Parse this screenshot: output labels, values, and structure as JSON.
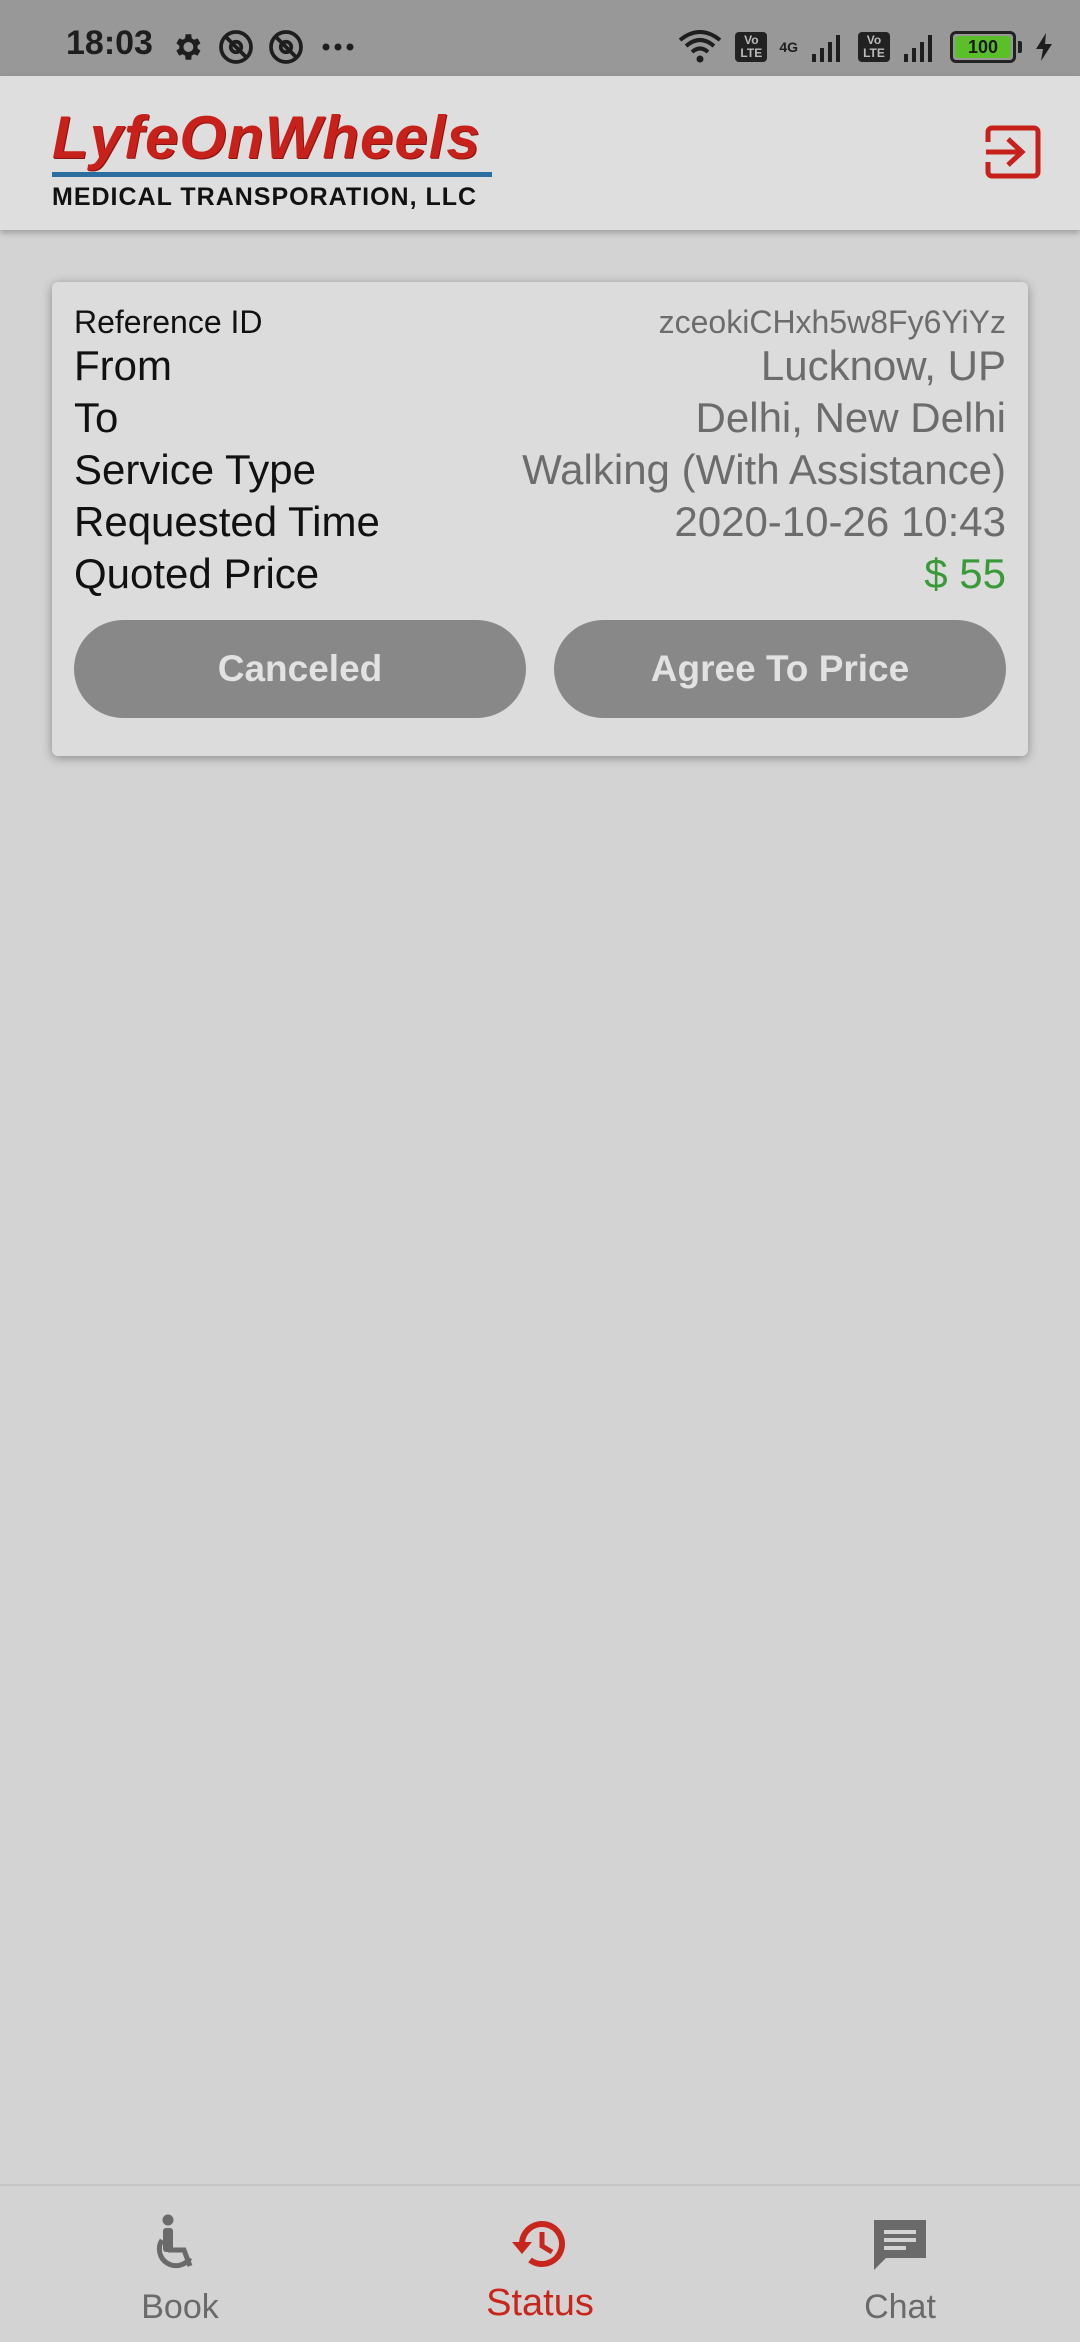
{
  "status_bar": {
    "time": "18:03",
    "icons_left": [
      "settings-icon",
      "at-sign-icon",
      "at-sign-icon",
      "more-dots-icon"
    ],
    "network": "4G",
    "volte_label": "Vo LTE",
    "battery": "100"
  },
  "header": {
    "logo_title": "LyfeOnWheels",
    "logo_subtitle": "MEDICAL TRANSPORATION, LLC",
    "logout_icon": "logout-icon",
    "brand_color": "#c8201a"
  },
  "request": {
    "reference_label": "Reference ID",
    "reference_value": "zceokiCHxh5w8Fy6YiYz",
    "from_label": "From",
    "from_value": "Lucknow, UP",
    "to_label": "To",
    "to_value": "Delhi, New Delhi",
    "service_label": "Service Type",
    "service_value": "Walking (With Assistance)",
    "time_label": "Requested Time",
    "time_value": "2020-10-26 10:43",
    "price_label": "Quoted Price",
    "price_value": "$ 55",
    "price_color": "#3a9a3a",
    "cancel_button": "Canceled",
    "agree_button": "Agree To Price"
  },
  "nav": {
    "items": [
      {
        "label": "Book",
        "icon": "wheelchair-icon",
        "active": false
      },
      {
        "label": "Status",
        "icon": "history-icon",
        "active": true
      },
      {
        "label": "Chat",
        "icon": "chat-icon",
        "active": false
      }
    ],
    "active_color": "#c8261c"
  }
}
